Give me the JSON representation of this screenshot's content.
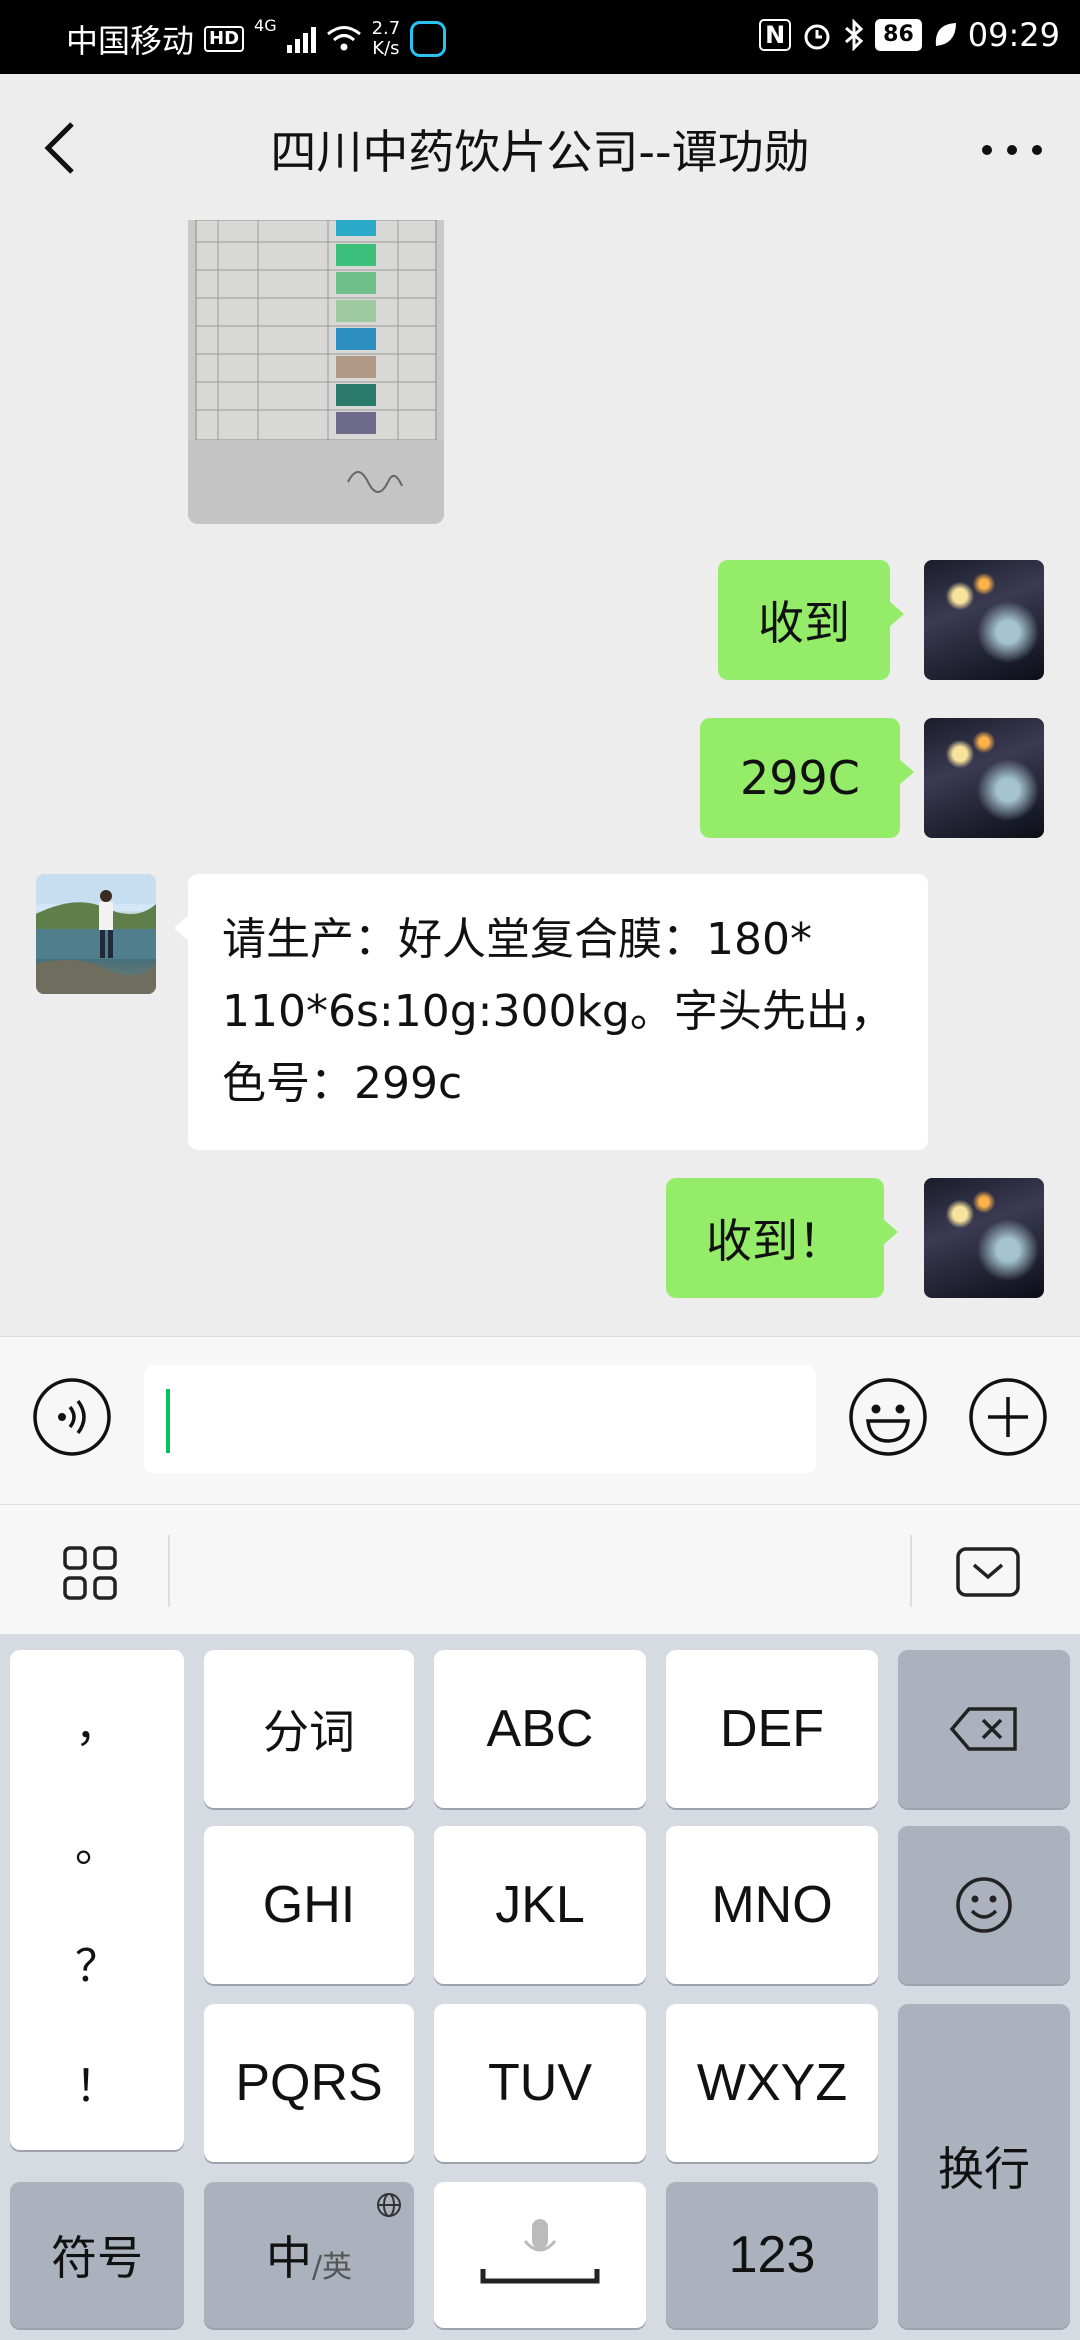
{
  "status_bar": {
    "carrier": "中国移动",
    "hd_badge": "HD",
    "network": "4G",
    "speed_value": "2.7",
    "speed_unit": "K/s",
    "nfc": "N",
    "battery": "86",
    "time": "09:29"
  },
  "header": {
    "title": "四川中药饮片公司--谭功勋"
  },
  "messages": [
    {
      "side": "left",
      "type": "image"
    },
    {
      "side": "right",
      "type": "text",
      "text": "收到"
    },
    {
      "side": "right",
      "type": "text",
      "text": "299C"
    },
    {
      "side": "left",
      "type": "text",
      "lines": [
        "请生产：好人堂复合膜：180*",
        "110*6s:10g:300kg。字头先出，",
        "色号：299c"
      ]
    },
    {
      "side": "right",
      "type": "text",
      "text": "收到！"
    }
  ],
  "input": {
    "value": ""
  },
  "keyboard": {
    "punctuation": [
      "，",
      "。",
      "？",
      "！"
    ],
    "keys": {
      "fenci": "分词",
      "abc": "ABC",
      "def": "DEF",
      "ghi": "GHI",
      "jkl": "JKL",
      "mno": "MNO",
      "pqrs": "PQRS",
      "tuv": "TUV",
      "wxyz": "WXYZ",
      "enter": "换行",
      "symbols": "符号",
      "lang_main": "中",
      "lang_sub": "/英",
      "numbers": "123"
    }
  },
  "colors": {
    "sent_bubble": "#95ec69",
    "received_bubble": "#ffffff",
    "caret": "#07c160",
    "chat_bg": "#ededed"
  }
}
